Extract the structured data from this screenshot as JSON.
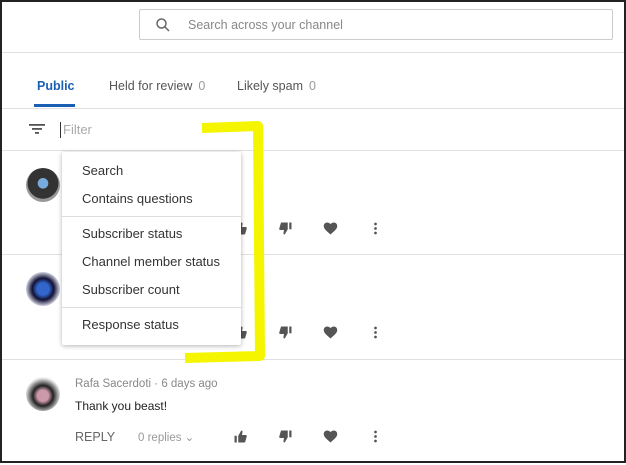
{
  "search": {
    "placeholder": "Search across your channel"
  },
  "tabs": [
    {
      "label": "Public",
      "count": ""
    },
    {
      "label": "Held for review",
      "count": "0"
    },
    {
      "label": "Likely spam",
      "count": "0"
    }
  ],
  "filter": {
    "placeholder": "Filter"
  },
  "filter_menu": [
    "Search",
    "Contains questions",
    "Subscriber status",
    "Channel member status",
    "Subscriber count",
    "Response status"
  ],
  "comments": [
    {
      "author": "Rafa Sacerdoti",
      "time": "6 days ago",
      "text": "Thank you beast!",
      "reply": "REPLY",
      "replies": "0 replies"
    }
  ],
  "colors": {
    "accent": "#1a5fb4",
    "highlight": "#f5f500"
  }
}
